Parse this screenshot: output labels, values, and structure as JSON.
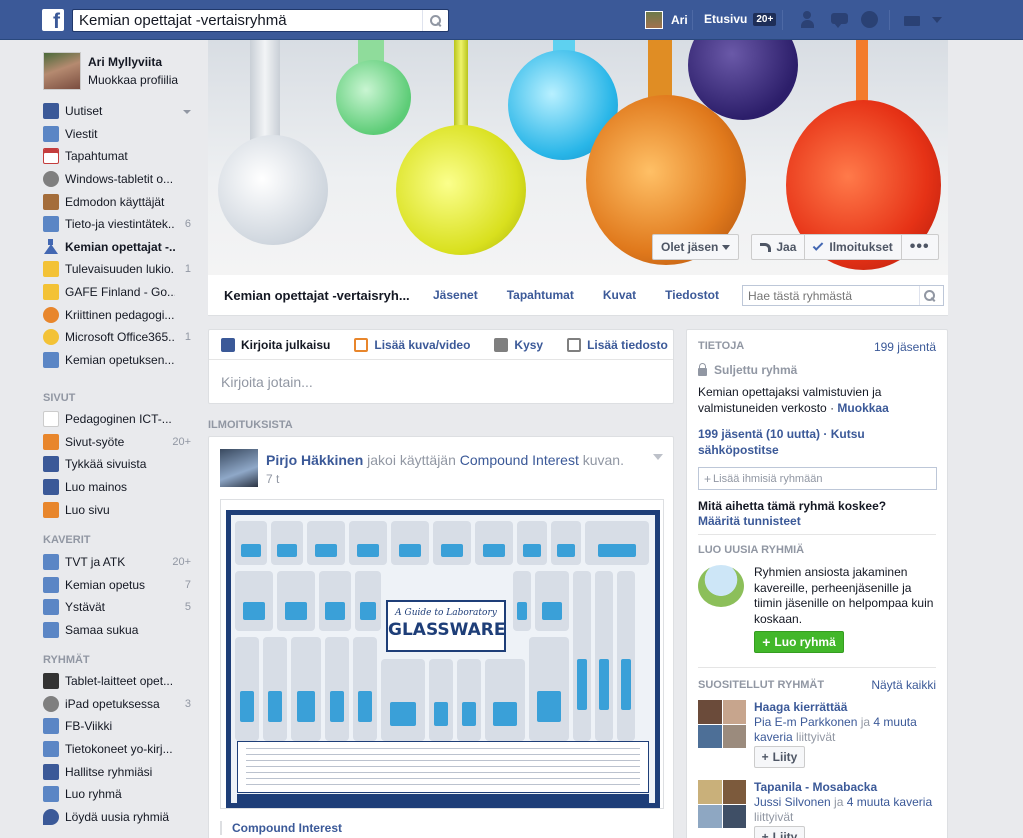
{
  "topbar": {
    "logo": "f",
    "search_value": "Kemian opettajat -vertaisryhmä",
    "user_name": "Ari",
    "home_label": "Etusivu",
    "home_count": "20+"
  },
  "profile": {
    "name": "Ari Myllyviita",
    "edit_label": "Muokkaa profiilia"
  },
  "sidebar": {
    "favorites": [
      {
        "label": "Uutiset",
        "count": "",
        "icon": "news-icon"
      },
      {
        "label": "Viestit",
        "count": "",
        "icon": "messages-icon"
      },
      {
        "label": "Tapahtumat",
        "count": "",
        "icon": "calendar-icon"
      },
      {
        "label": "Windows-tabletit o...",
        "count": "",
        "icon": "globe-icon"
      },
      {
        "label": "Edmodon käyttäjät",
        "count": "",
        "icon": "book-icon"
      },
      {
        "label": "Tieto-ja viestintätek...",
        "count": "6",
        "icon": "group-icon"
      },
      {
        "label": "Kemian opettajat -...",
        "count": "",
        "icon": "flask-icon"
      },
      {
        "label": "Tulevaisuuden lukio...",
        "count": "1",
        "icon": "house-icon"
      },
      {
        "label": "GAFE Finland - Go...",
        "count": "",
        "icon": "house-icon"
      },
      {
        "label": "Kriittinen pedagogi...",
        "count": "",
        "icon": "brain-icon"
      },
      {
        "label": "Microsoft Office365...",
        "count": "1",
        "icon": "bulb-icon"
      },
      {
        "label": "Kemian opetuksen...",
        "count": "",
        "icon": "group-icon"
      }
    ],
    "pages_heading": "SIVUT",
    "pages": [
      {
        "label": "Pedagoginen ICT-...",
        "count": "",
        "icon": "page-icon"
      },
      {
        "label": "Sivut-syöte",
        "count": "20+",
        "icon": "megaphone-icon"
      },
      {
        "label": "Tykkää sivuista",
        "count": "",
        "icon": "like-icon"
      },
      {
        "label": "Luo mainos",
        "count": "",
        "icon": "chart-icon"
      },
      {
        "label": "Luo sivu",
        "count": "",
        "icon": "plus-icon"
      }
    ],
    "friends_heading": "KAVERIT",
    "friends": [
      {
        "label": "TVT ja ATK",
        "count": "20+",
        "icon": "friends-list-icon"
      },
      {
        "label": "Kemian opetus",
        "count": "7",
        "icon": "friends-list-icon"
      },
      {
        "label": "Ystävät",
        "count": "5",
        "icon": "friends-list-icon"
      },
      {
        "label": "Samaa sukua",
        "count": "",
        "icon": "friends-list-icon"
      }
    ],
    "groups_heading": "RYHMÄT",
    "groups": [
      {
        "label": "Tablet-laitteet opet...",
        "count": "",
        "icon": "graduation-cap-icon"
      },
      {
        "label": "iPad opetuksessa",
        "count": "3",
        "icon": "globe-icon"
      },
      {
        "label": "FB-Viikki",
        "count": "",
        "icon": "group-icon"
      },
      {
        "label": "Tietokoneet yo-kirj...",
        "count": "",
        "icon": "group-icon"
      },
      {
        "label": "Hallitse ryhmiäsi",
        "count": "",
        "icon": "manage-icon"
      },
      {
        "label": "Luo ryhmä",
        "count": "",
        "icon": "group-icon"
      },
      {
        "label": "Löydä uusia ryhmiä",
        "count": "",
        "icon": "find-icon"
      }
    ]
  },
  "cover": {
    "member_button": "Olet jäsen",
    "share_button": "Jaa",
    "notifications_button": "Ilmoitukset",
    "more_button": "•••"
  },
  "group_nav": {
    "title": "Kemian opettajat -vertaisryh...",
    "tabs": [
      "Jäsenet",
      "Tapahtumat",
      "Kuvat",
      "Tiedostot"
    ],
    "search_placeholder": "Hae tästä ryhmästä"
  },
  "composer": {
    "tabs": [
      "Kirjoita julkaisu",
      "Lisää kuva/video",
      "Kysy",
      "Lisää tiedosto"
    ],
    "placeholder": "Kirjoita jotain..."
  },
  "announcements_heading": "ILMOITUKSISTA",
  "post": {
    "author": "Pirjo Häkkinen",
    "action": " jakoi käyttäjän ",
    "source_page": "Compound Interest",
    "object": " kuvan.",
    "time": "7 t",
    "image_title_small": "A Guide to Laboratory",
    "image_title_big": "GLASSWARE",
    "source_label": "Compound Interest"
  },
  "about": {
    "heading": "TIETOJA",
    "member_count_link": "199 jäsentä",
    "privacy": "Suljettu ryhmä",
    "description": "Kemian opettajaksi valmistuvien ja valmistuneiden verkosto · ",
    "edit_link": "Muokkaa",
    "members_line": "199 jäsentä   (10 uutta) · Kutsu sähköpostitse",
    "add_people_placeholder": "Lisää ihmisiä ryhmään",
    "topic_question": "Mitä aihetta tämä ryhmä koskee?",
    "topic_link": "Määritä tunnisteet"
  },
  "create_groups": {
    "heading": "LUO UUSIA RYHMIÄ",
    "text": "Ryhmien ansiosta jakaminen kavereille, perheenjäsenille ja tiimin jäsenille on helpompaa kuin koskaan.",
    "button": "Luo ryhmä"
  },
  "suggested": {
    "heading": "SUOSITELLUT RYHMÄT",
    "see_all": "Näytä kaikki",
    "groups": [
      {
        "name": "Haaga kierrättää",
        "member1": "Pia E-m Parkkonen",
        "connector": " ja ",
        "others": "4 muuta kaveria",
        "suffix": " liittyivät",
        "join": "Liity"
      },
      {
        "name": "Tapanila - Mosabacka",
        "member1": "Jussi Silvonen",
        "connector": " ja ",
        "others": "4 muuta kaveria",
        "suffix": " liittyivät",
        "join": "Liity"
      }
    ]
  },
  "colors": {
    "brand_blue": "#3b5998",
    "link_blue": "#3b5998",
    "create_green": "#42b72a",
    "page_background": "#e9eaed"
  }
}
